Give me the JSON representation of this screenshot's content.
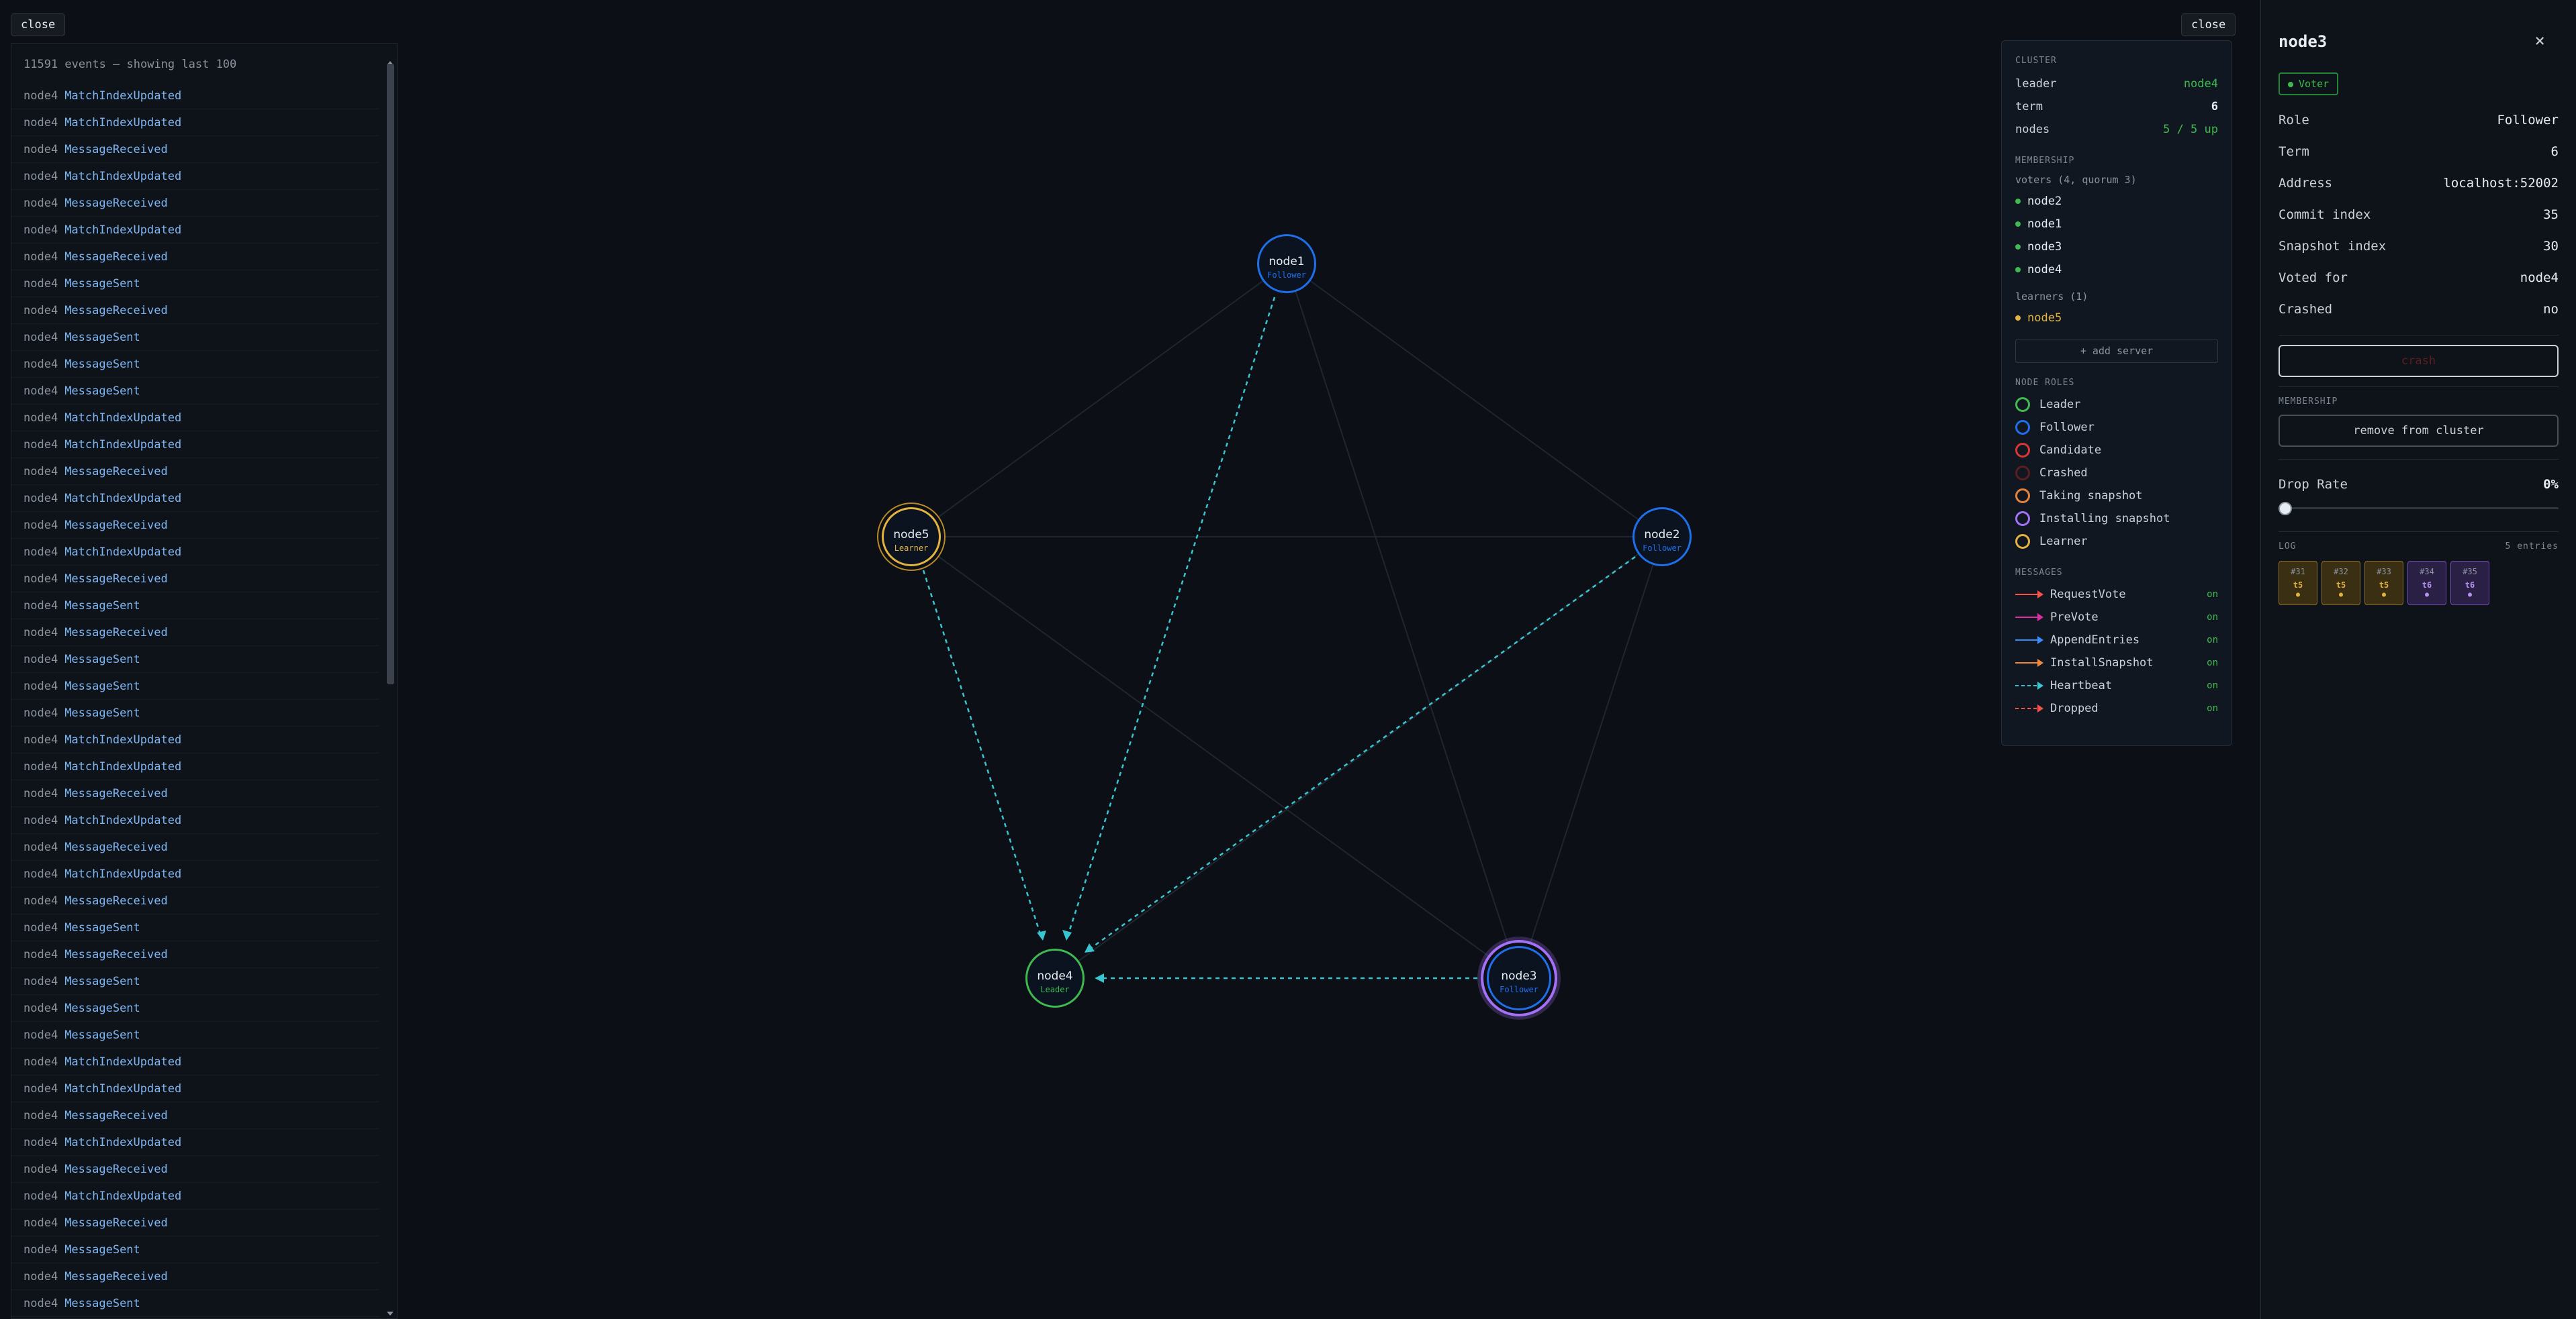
{
  "top": {
    "left_close": "close",
    "right_close": "close"
  },
  "events": {
    "header": "11591 events — showing last 100",
    "items": [
      {
        "node": "node4",
        "type": "MatchIndexUpdated"
      },
      {
        "node": "node4",
        "type": "MatchIndexUpdated"
      },
      {
        "node": "node4",
        "type": "MessageReceived"
      },
      {
        "node": "node4",
        "type": "MatchIndexUpdated"
      },
      {
        "node": "node4",
        "type": "MessageReceived"
      },
      {
        "node": "node4",
        "type": "MatchIndexUpdated"
      },
      {
        "node": "node4",
        "type": "MessageReceived"
      },
      {
        "node": "node4",
        "type": "MessageSent"
      },
      {
        "node": "node4",
        "type": "MessageReceived"
      },
      {
        "node": "node4",
        "type": "MessageSent"
      },
      {
        "node": "node4",
        "type": "MessageSent"
      },
      {
        "node": "node4",
        "type": "MessageSent"
      },
      {
        "node": "node4",
        "type": "MatchIndexUpdated"
      },
      {
        "node": "node4",
        "type": "MatchIndexUpdated"
      },
      {
        "node": "node4",
        "type": "MessageReceived"
      },
      {
        "node": "node4",
        "type": "MatchIndexUpdated"
      },
      {
        "node": "node4",
        "type": "MessageReceived"
      },
      {
        "node": "node4",
        "type": "MatchIndexUpdated"
      },
      {
        "node": "node4",
        "type": "MessageReceived"
      },
      {
        "node": "node4",
        "type": "MessageSent"
      },
      {
        "node": "node4",
        "type": "MessageReceived"
      },
      {
        "node": "node4",
        "type": "MessageSent"
      },
      {
        "node": "node4",
        "type": "MessageSent"
      },
      {
        "node": "node4",
        "type": "MessageSent"
      },
      {
        "node": "node4",
        "type": "MatchIndexUpdated"
      },
      {
        "node": "node4",
        "type": "MatchIndexUpdated"
      },
      {
        "node": "node4",
        "type": "MessageReceived"
      },
      {
        "node": "node4",
        "type": "MatchIndexUpdated"
      },
      {
        "node": "node4",
        "type": "MessageReceived"
      },
      {
        "node": "node4",
        "type": "MatchIndexUpdated"
      },
      {
        "node": "node4",
        "type": "MessageReceived"
      },
      {
        "node": "node4",
        "type": "MessageSent"
      },
      {
        "node": "node4",
        "type": "MessageReceived"
      },
      {
        "node": "node4",
        "type": "MessageSent"
      },
      {
        "node": "node4",
        "type": "MessageSent"
      },
      {
        "node": "node4",
        "type": "MessageSent"
      },
      {
        "node": "node4",
        "type": "MatchIndexUpdated"
      },
      {
        "node": "node4",
        "type": "MatchIndexUpdated"
      },
      {
        "node": "node4",
        "type": "MessageReceived"
      },
      {
        "node": "node4",
        "type": "MatchIndexUpdated"
      },
      {
        "node": "node4",
        "type": "MessageReceived"
      },
      {
        "node": "node4",
        "type": "MatchIndexUpdated"
      },
      {
        "node": "node4",
        "type": "MessageReceived"
      },
      {
        "node": "node4",
        "type": "MessageSent"
      },
      {
        "node": "node4",
        "type": "MessageReceived"
      },
      {
        "node": "node4",
        "type": "MessageSent"
      }
    ]
  },
  "nodes": {
    "node1": {
      "name": "node1",
      "role": "Follower"
    },
    "node2": {
      "name": "node2",
      "role": "Follower"
    },
    "node3": {
      "name": "node3",
      "role": "Follower"
    },
    "node4": {
      "name": "node4",
      "role": "Leader"
    },
    "node5": {
      "name": "node5",
      "role": "Learner"
    }
  },
  "cluster": {
    "section_label": "CLUSTER",
    "leader_label": "leader",
    "leader_value": "node4",
    "term_label": "term",
    "term_value": "6",
    "nodes_label": "nodes",
    "nodes_value": "5 / 5 up",
    "membership_label": "MEMBERSHIP",
    "voters_label": "voters (4, quorum 3)",
    "voters": [
      "node2",
      "node1",
      "node3",
      "node4"
    ],
    "learners_label": "learners (1)",
    "learners": [
      "node5"
    ],
    "add_server": "+ add server",
    "roles_label": "NODE ROLES",
    "roles": [
      {
        "label": "Leader",
        "color": "#3fb950"
      },
      {
        "label": "Follower",
        "color": "#1f6feb"
      },
      {
        "label": "Candidate",
        "color": "#da3633"
      },
      {
        "label": "Crashed",
        "color": "#5a1e1e"
      },
      {
        "label": "Taking snapshot",
        "color": "#e3823a"
      },
      {
        "label": "Installing snapshot",
        "color": "#a371f7"
      },
      {
        "label": "Learner",
        "color": "#e3b341"
      }
    ],
    "messages_label": "MESSAGES",
    "messages": [
      {
        "label": "RequestVote",
        "color": "#f85149",
        "state": "on"
      },
      {
        "label": "PreVote",
        "color": "#db2ea0",
        "state": "on"
      },
      {
        "label": "AppendEntries",
        "color": "#388bfd",
        "state": "on"
      },
      {
        "label": "InstallSnapshot",
        "color": "#f0883e",
        "state": "on"
      },
      {
        "label": "Heartbeat",
        "color": "#39c5cf",
        "state": "on"
      },
      {
        "label": "Dropped",
        "color": "#f85149",
        "state": "on"
      }
    ]
  },
  "detail": {
    "title": "node3",
    "close": "×",
    "badge": "Voter",
    "rows": [
      {
        "k": "Role",
        "v": "Follower"
      },
      {
        "k": "Term",
        "v": "6"
      },
      {
        "k": "Address",
        "v": "localhost:52002"
      },
      {
        "k": "Commit index",
        "v": "35"
      },
      {
        "k": "Snapshot index",
        "v": "30"
      },
      {
        "k": "Voted for",
        "v": "node4"
      },
      {
        "k": "Crashed",
        "v": "no"
      }
    ],
    "crash_button": "crash",
    "membership_label": "MEMBERSHIP",
    "remove_button": "remove from cluster",
    "drop_rate_label": "Drop Rate",
    "drop_rate_value": "0%",
    "drop_rate": 0,
    "log_label": "LOG",
    "log_count": "5 entries",
    "log": [
      {
        "idx": "#31",
        "term": "t5",
        "kind": "snap"
      },
      {
        "idx": "#32",
        "term": "t5",
        "kind": "snap"
      },
      {
        "idx": "#33",
        "term": "t5",
        "kind": "snap"
      },
      {
        "idx": "#34",
        "term": "t6",
        "kind": "inst"
      },
      {
        "idx": "#35",
        "term": "t6",
        "kind": "inst"
      }
    ]
  }
}
